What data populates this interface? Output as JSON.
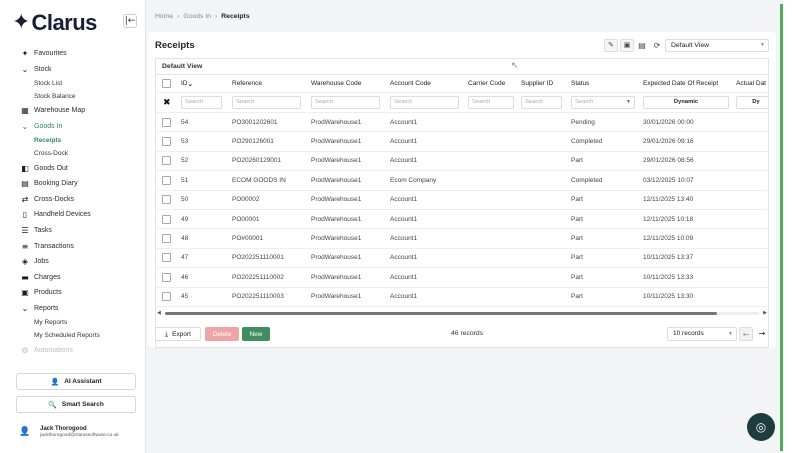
{
  "brand": {
    "logo_star": "✦",
    "logo_text": "Clarus",
    "collapse_icon": "|←"
  },
  "nav": {
    "items": [
      {
        "label": "Favourites",
        "icon": "✦"
      },
      {
        "label": "Stock",
        "icon": "⌄"
      },
      {
        "sub": "Stock List"
      },
      {
        "sub": "Stock Balance"
      },
      {
        "label": "Warehouse Map",
        "icon": "▦"
      },
      {
        "label": "Goods In",
        "icon": "⌄",
        "active": true
      },
      {
        "sub": "Receipts",
        "active": true
      },
      {
        "sub": "Cross-Dock"
      },
      {
        "label": "Goods Out",
        "icon": "◧"
      },
      {
        "label": "Booking Diary",
        "icon": "▤"
      },
      {
        "label": "Cross-Docks",
        "icon": "⇄"
      },
      {
        "label": "Handheld Devices",
        "icon": "▯"
      },
      {
        "label": "Tasks",
        "icon": "☰"
      },
      {
        "label": "Transactions",
        "icon": "≡"
      },
      {
        "label": "Jobs",
        "icon": "◈"
      },
      {
        "label": "Charges",
        "icon": "▬"
      },
      {
        "label": "Products",
        "icon": "▣"
      },
      {
        "label": "Reports",
        "icon": "⌄"
      },
      {
        "sub": "My Reports"
      },
      {
        "sub": "My Scheduled Reports"
      },
      {
        "label": "Automations",
        "icon": "⚙",
        "faded": true
      }
    ],
    "ai_assistant": "AI Assistant",
    "smart_search": "Smart Search"
  },
  "user": {
    "name": "Jack Thorogood",
    "email": "jackthorogood@clarussoftware.co.uk"
  },
  "breadcrumb": {
    "home": "Home",
    "section": "Goods In",
    "current": "Receipts",
    "sep": "›"
  },
  "page": {
    "title": "Receipts",
    "view": "Default View",
    "grid_title": "Default View"
  },
  "grid": {
    "columns": [
      "ID",
      "Reference",
      "Warehouse Code",
      "Account Code",
      "Carrier Code",
      "Supplier ID",
      "Status",
      "Expected Date Of Receipt",
      "Actual Dat"
    ],
    "search_placeholder": "Search",
    "dynamic_label": "Dynamic",
    "dynamic_cut": "Dy",
    "rows": [
      {
        "id": "54",
        "ref": "PO3001202601",
        "wh": "ProdWarehouse1",
        "acct": "Account1",
        "status": "Pending",
        "date": "30/01/2026 00:00"
      },
      {
        "id": "53",
        "ref": "PO290126001",
        "wh": "ProdWarehouse1",
        "acct": "Account1",
        "status": "Completed",
        "date": "29/01/2026 09:16"
      },
      {
        "id": "52",
        "ref": "PO20260129001",
        "wh": "ProdWarehouse1",
        "acct": "Account1",
        "status": "Part",
        "date": "29/01/2026 08:56"
      },
      {
        "id": "51",
        "ref": "ECOM GOODS IN",
        "wh": "ProdWarehouse1",
        "acct": "Ecom Company",
        "status": "Completed",
        "date": "03/12/2025 10:07"
      },
      {
        "id": "50",
        "ref": "PO00002",
        "wh": "ProdWarehouse1",
        "acct": "Account1",
        "status": "Part",
        "date": "12/11/2025 13:40"
      },
      {
        "id": "49",
        "ref": "PO00001",
        "wh": "ProdWarehouse1",
        "acct": "Account1",
        "status": "Part",
        "date": "12/11/2025 10:18"
      },
      {
        "id": "48",
        "ref": "PO#00001",
        "wh": "ProdWarehouse1",
        "acct": "Account1",
        "status": "Part",
        "date": "12/11/2025 10:09"
      },
      {
        "id": "47",
        "ref": "PO202251110001",
        "wh": "ProdWarehouse1",
        "acct": "Account1",
        "status": "Part",
        "date": "10/11/2025 13:37"
      },
      {
        "id": "46",
        "ref": "PO202251110002",
        "wh": "ProdWarehouse1",
        "acct": "Account1",
        "status": "Part",
        "date": "10/11/2025 13:33"
      },
      {
        "id": "45",
        "ref": "PO202251110003",
        "wh": "ProdWarehouse1",
        "acct": "Account1",
        "status": "Part",
        "date": "10/11/2025 13:30"
      }
    ]
  },
  "footer": {
    "export": "Export",
    "delete": "Delete",
    "new": "New",
    "records": "46 records",
    "page_size": "10 records"
  },
  "colors": {
    "accent": "#2e8b57",
    "new_button": "#3e8f5e",
    "delete_button": "#f0a5a5",
    "help_button": "#1d3c3c",
    "brand": "#1a1d3a"
  }
}
